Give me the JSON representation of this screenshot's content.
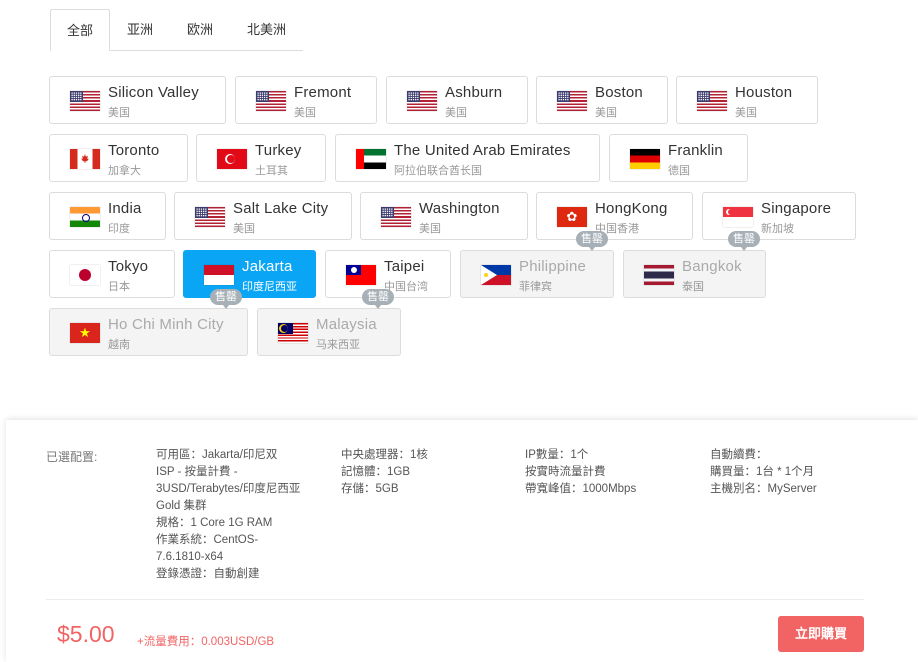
{
  "tabs": [
    "全部",
    "亚洲",
    "欧洲",
    "北美洲"
  ],
  "badge_text": "售罄",
  "locations": {
    "silicon_valley": {
      "name": "Silicon Valley",
      "country": "美国"
    },
    "fremont": {
      "name": "Fremont",
      "country": "美国"
    },
    "ashburn": {
      "name": "Ashburn",
      "country": "美国"
    },
    "boston": {
      "name": "Boston",
      "country": "美国"
    },
    "houston": {
      "name": "Houston",
      "country": "美国"
    },
    "toronto": {
      "name": "Toronto",
      "country": "加拿大"
    },
    "turkey": {
      "name": "Turkey",
      "country": "土耳其"
    },
    "uae": {
      "name": "The United Arab Emirates",
      "country": "阿拉伯联合酋长国"
    },
    "franklin": {
      "name": "Franklin",
      "country": "德国"
    },
    "india": {
      "name": "India",
      "country": "印度"
    },
    "salt_lake": {
      "name": "Salt Lake City",
      "country": "美国"
    },
    "washington": {
      "name": "Washington",
      "country": "美国"
    },
    "hongkong": {
      "name": "HongKong",
      "country": "中国香港"
    },
    "singapore": {
      "name": "Singapore",
      "country": "新加坡"
    },
    "tokyo": {
      "name": "Tokyo",
      "country": "日本"
    },
    "jakarta": {
      "name": "Jakarta",
      "country": "印度尼西亚"
    },
    "taipei": {
      "name": "Taipei",
      "country": "中国台湾"
    },
    "philippine": {
      "name": "Philippine",
      "country": "菲律宾"
    },
    "bangkok": {
      "name": "Bangkok",
      "country": "泰国"
    },
    "hcmc": {
      "name": "Ho Chi Minh City",
      "country": "越南"
    },
    "malaysia": {
      "name": "Malaysia",
      "country": "马来西亚"
    }
  },
  "summary": {
    "label": "已選配置:",
    "col1": [
      "可用區：Jakarta/印尼双",
      "ISP - 按量計費 - 3USD/Terabytes/印度尼西亚 Gold 集群",
      "規格：1 Core 1G RAM",
      "作業系統：CentOS-7.6.1810-x64",
      "登錄憑證：自動創建"
    ],
    "col2": [
      "中央處理器：1核",
      "記憶體：1GB",
      "存儲：5GB"
    ],
    "col3": [
      "IP數量：1个",
      "按實時流量計費",
      "帶寬峰值：1000Mbps"
    ],
    "col4": [
      "自動續費：",
      "購買量：1台 * 1个月",
      "主機別名：MyServer"
    ]
  },
  "price": "$5.00",
  "traffic_fee": "+流量費用：0.003USD/GB",
  "buy_label": "立即購買",
  "colors": {
    "selected": "#0aa6f5",
    "accent": "#f26363",
    "soldout_badge": "#a7b0b6"
  }
}
